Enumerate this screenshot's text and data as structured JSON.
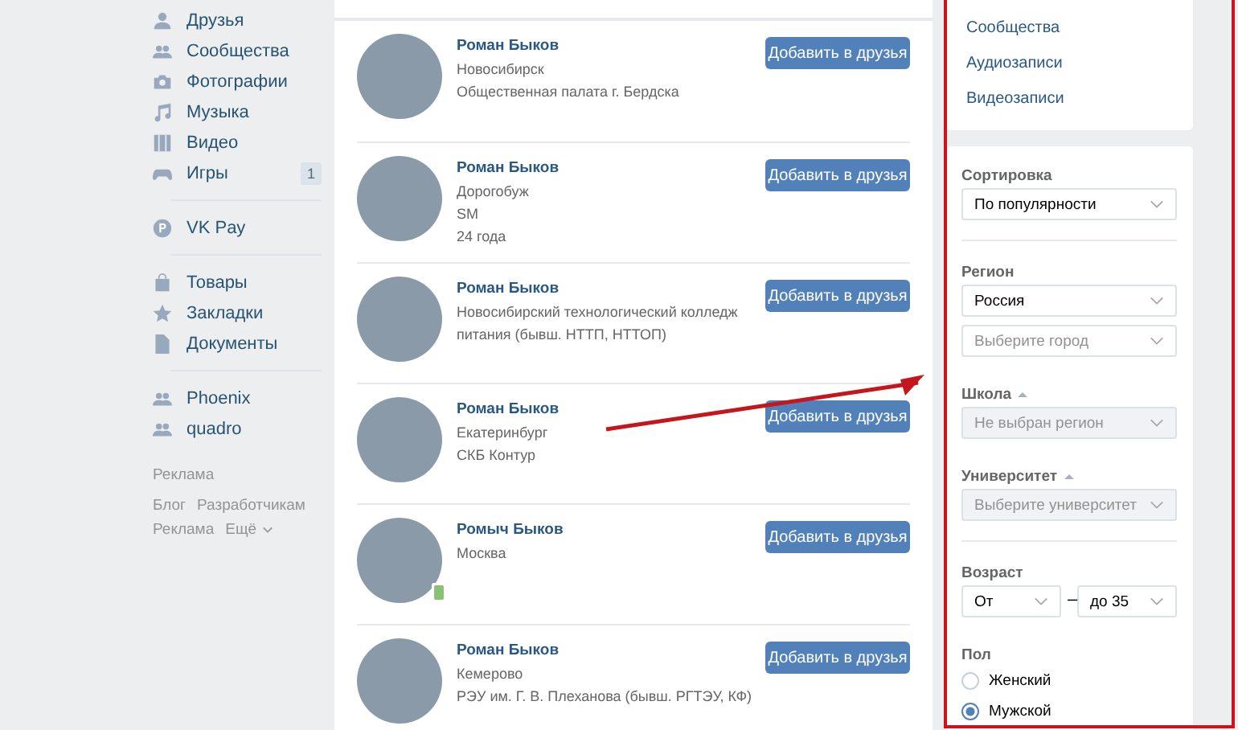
{
  "sidebar": {
    "groups": [
      [
        {
          "label": "Друзья"
        },
        {
          "label": "Сообщества"
        },
        {
          "label": "Фотографии"
        },
        {
          "label": "Музыка"
        },
        {
          "label": "Видео"
        },
        {
          "label": "Игры",
          "badge": "1"
        }
      ],
      [
        {
          "label": "VK Pay"
        }
      ],
      [
        {
          "label": "Товары"
        },
        {
          "label": "Закладки"
        },
        {
          "label": "Документы"
        }
      ],
      [
        {
          "label": "Phoenix"
        },
        {
          "label": "quadro"
        }
      ]
    ],
    "ads_label": "Реклама",
    "footer_links": [
      {
        "label": "Блог",
        "dropdown": false
      },
      {
        "label": "Разработчикам",
        "dropdown": false
      },
      {
        "label": "Реклама",
        "dropdown": false
      },
      {
        "label": "Ещё",
        "dropdown": true
      }
    ]
  },
  "people": [
    {
      "name": "Роман Быков",
      "lines": [
        "Новосибирск",
        "Общественная палата г. Бердска"
      ],
      "button": "Добавить в друзья",
      "mobile_online": false
    },
    {
      "name": "Роман Быков",
      "lines": [
        "Дорогобуж",
        "SM",
        "24 года"
      ],
      "button": "Добавить в друзья",
      "mobile_online": false
    },
    {
      "name": "Роман Быков",
      "lines": [
        "Новосибирский технологический колледж питания (бывш. НТТП, НТТОП)"
      ],
      "button": "Добавить в друзья",
      "mobile_online": false
    },
    {
      "name": "Роман Быков",
      "lines": [
        "Екатеринбург",
        "СКБ Контур"
      ],
      "button": "Добавить в друзья",
      "mobile_online": false
    },
    {
      "name": "Ромыч Быков",
      "lines": [
        "Москва"
      ],
      "button": "Добавить в друзья",
      "mobile_online": true
    },
    {
      "name": "Роман Быков",
      "lines": [
        "Кемерово",
        "РЭУ им. Г. В. Плеханова (бывш. РГТЭУ, КФ)"
      ],
      "button": "Добавить в друзья",
      "mobile_online": false
    }
  ],
  "search_sections": [
    "Сообщества",
    "Аудиозаписи",
    "Видеозаписи"
  ],
  "filters": [
    {
      "kind": "select",
      "title": "Сортировка",
      "collapsible": false,
      "divider": true,
      "selects": [
        {
          "value": "По популярности",
          "disabled": false
        }
      ]
    },
    {
      "kind": "select",
      "title": "Регион",
      "collapsible": false,
      "divider": false,
      "selects": [
        {
          "value": "Россия",
          "disabled": false
        },
        {
          "placeholder": "Выберите город",
          "disabled": false
        }
      ]
    },
    {
      "kind": "select",
      "title": "Школа",
      "collapsible": true,
      "divider": false,
      "selects": [
        {
          "placeholder": "Не выбран регион",
          "disabled": true
        }
      ]
    },
    {
      "kind": "select",
      "title": "Университет",
      "collapsible": true,
      "divider": true,
      "selects": [
        {
          "placeholder": "Выберите университет",
          "disabled": true
        }
      ]
    },
    {
      "kind": "range",
      "title": "Возраст",
      "collapsible": false,
      "divider": false,
      "selects": [
        {
          "value": "От",
          "disabled": false
        },
        {
          "value": "до 35",
          "disabled": false
        }
      ],
      "separator": "–"
    },
    {
      "kind": "radio",
      "title": "Пол",
      "collapsible": false,
      "divider": false,
      "options": [
        {
          "label": "Женский",
          "selected": false
        },
        {
          "label": "Мужской",
          "selected": true
        }
      ]
    }
  ]
}
